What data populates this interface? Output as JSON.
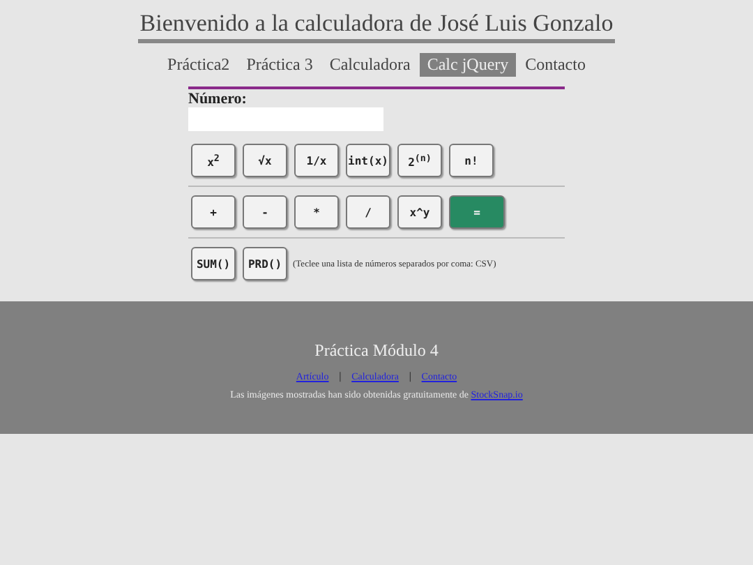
{
  "header": {
    "title": "Bienvenido a la calculadora de José Luis Gonzalo"
  },
  "nav": [
    {
      "label": "Práctica2",
      "selected": false
    },
    {
      "label": "Práctica 3",
      "selected": false
    },
    {
      "label": "Calculadora",
      "selected": false
    },
    {
      "label": "Calc jQuery",
      "selected": true
    },
    {
      "label": "Contacto",
      "selected": false
    }
  ],
  "form": {
    "label": "Número:"
  },
  "button_rows": [
    [
      {
        "label": "x$^{2}$",
        "kind": "normal"
      },
      {
        "label": "√x",
        "kind": "normal"
      },
      {
        "label": "1/x",
        "kind": "normal"
      },
      {
        "label": "int(x)",
        "kind": "normal"
      },
      {
        "label": "2$^{(n)}$",
        "kind": "normal"
      },
      {
        "label": "n!",
        "kind": "normal"
      }
    ],
    [
      {
        "label": "+",
        "kind": "normal"
      },
      {
        "label": "-",
        "kind": "normal"
      },
      {
        "label": "*",
        "kind": "normal"
      },
      {
        "label": "/",
        "kind": "normal"
      },
      {
        "label": "x^y",
        "kind": "normal"
      },
      {
        "label": "=",
        "kind": "primary"
      }
    ],
    [
      {
        "label": "SUM()",
        "kind": "normal"
      },
      {
        "label": "PRD()",
        "kind": "normal"
      }
    ]
  ],
  "hint": "(Teclee una lista de números separados por coma: CSV)",
  "footer": {
    "title": "Práctica Módulo 4",
    "links": [
      "Artículo",
      "Calculadora",
      "Contacto"
    ],
    "separator": "|",
    "credit": "Las imágenes mostradas han sido obtenidas gratuitamente de ",
    "credit_link": "StockSnap.io"
  }
}
